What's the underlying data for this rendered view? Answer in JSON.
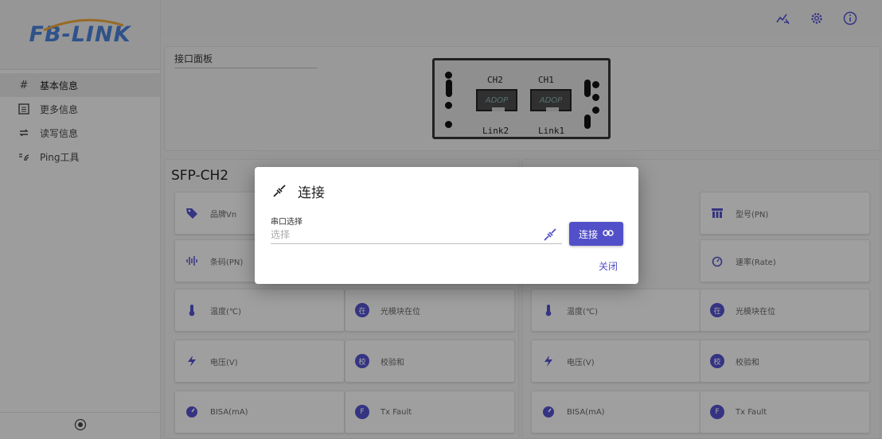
{
  "brand": {
    "logo_text": "FB-LINK",
    "accent": "#5250c9",
    "logo_color": "#4a7fd4"
  },
  "sidebar": {
    "items": [
      {
        "label": "基本信息",
        "icon": "hash-icon",
        "active": true
      },
      {
        "label": "更多信息",
        "icon": "list-box-icon"
      },
      {
        "label": "读写信息",
        "icon": "swap-icon"
      },
      {
        "label": "Ping工具",
        "icon": "ping-icon"
      }
    ]
  },
  "panel": {
    "title": "接口面板",
    "ch2_label": "CH2",
    "ch1_label": "CH1",
    "link2_label": "Link2",
    "link1_label": "Link1",
    "port_brand": "ADOP"
  },
  "sections": {
    "left_title": "SFP-CH2"
  },
  "cards": {
    "brand": "品牌Vn",
    "barcode": "条码(PN)",
    "temp": "温度(℃)",
    "module_present": "光模块在位",
    "voltage": "电压(V)",
    "checksum": "校验和",
    "bias": "BISA(mA)",
    "txfault": "Tx Fault",
    "model": "型号(PN)",
    "rate": "速率(Rate)",
    "present_glyph": "在",
    "check_glyph": "校",
    "fault_glyph": "F"
  },
  "dialog": {
    "title": "连接",
    "field_label": "串口选择",
    "field_placeholder": "选择",
    "connect_label": "连接",
    "close_label": "关闭"
  }
}
